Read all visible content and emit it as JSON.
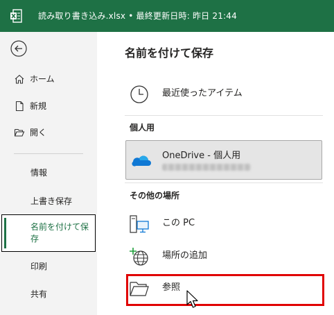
{
  "titlebar": {
    "title": "読み取り書き込み.xlsx • 最終更新日時: 昨日 21:44",
    "app_color": "#1e7145"
  },
  "nav": {
    "back_icon": "back-arrow-icon",
    "home": "ホーム",
    "new": "新規",
    "open": "開く",
    "info": "情報",
    "save": "上書き保存",
    "save_as": "名前を付けて保存",
    "print": "印刷",
    "share": "共有"
  },
  "main": {
    "title": "名前を付けて保存",
    "recent": "最近使ったアイテム",
    "personal_header": "個人用",
    "onedrive": {
      "name": "OneDrive - 個人用"
    },
    "other_header": "その他の場所",
    "this_pc": "この PC",
    "add_place": "場所の追加",
    "browse": "参照"
  },
  "colors": {
    "highlight": "#e00000",
    "accent": "#1e7145"
  }
}
